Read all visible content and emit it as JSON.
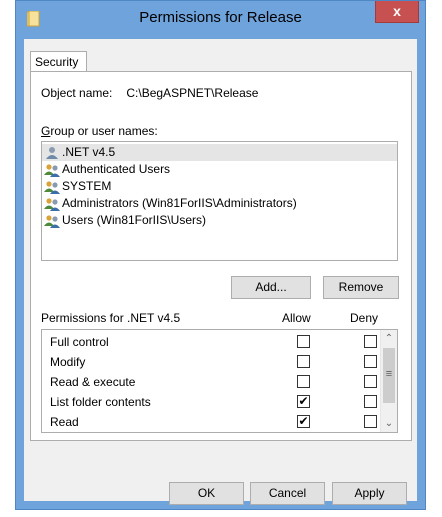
{
  "window": {
    "title": "Permissions for Release",
    "close_label": "x"
  },
  "tabs": [
    {
      "label": "Security"
    }
  ],
  "security": {
    "object_label": "Object name:",
    "object_value": "C:\\BegASPNET\\Release",
    "group_label": "Group or user names:",
    "users": [
      {
        "name": ".NET v4.5",
        "icon": "single-user-icon",
        "selected": true
      },
      {
        "name": "Authenticated Users",
        "icon": "user-group-icon"
      },
      {
        "name": "SYSTEM",
        "icon": "user-group-icon"
      },
      {
        "name": "Administrators (Win81ForIIS\\Administrators)",
        "icon": "user-group-icon"
      },
      {
        "name": "Users (Win81ForIIS\\Users)",
        "icon": "user-group-icon"
      }
    ],
    "add_label": "Add...",
    "remove_label": "Remove",
    "permissions_label": "Permissions for .NET v4.5",
    "allow_header": "Allow",
    "deny_header": "Deny",
    "permissions": [
      {
        "name": "Full control",
        "allow": false,
        "deny": false
      },
      {
        "name": "Modify",
        "allow": false,
        "deny": false
      },
      {
        "name": "Read & execute",
        "allow": false,
        "deny": false
      },
      {
        "name": "List folder contents",
        "allow": true,
        "deny": false
      },
      {
        "name": "Read",
        "allow": true,
        "deny": false
      }
    ]
  },
  "footer": {
    "ok_label": "OK",
    "cancel_label": "Cancel",
    "apply_label": "Apply"
  },
  "colors": {
    "titlebar": "#6fa3db",
    "close": "#c75050",
    "selection": "#e5e5e5"
  }
}
